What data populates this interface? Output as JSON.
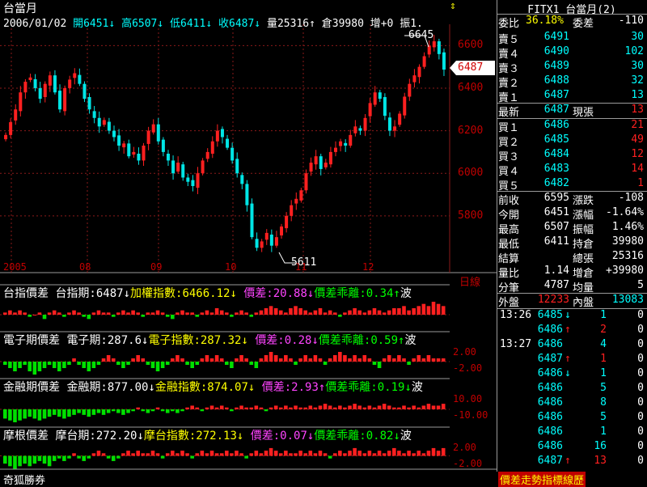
{
  "chart": {
    "symbol": "台當月",
    "info": [
      {
        "t": "2006/01/02",
        "c": "white"
      },
      {
        "t": "開6451↓",
        "c": "cyan"
      },
      {
        "t": "高6507↓",
        "c": "cyan"
      },
      {
        "t": "低6411↓",
        "c": "cyan"
      },
      {
        "t": "收6487↓",
        "c": "cyan"
      },
      {
        "t": "量25316↑",
        "c": "white"
      },
      {
        "t": "倉39980",
        "c": "white"
      },
      {
        "t": "增+0",
        "c": "white"
      },
      {
        "t": "振1.",
        "c": "white"
      }
    ],
    "y_ticks": [
      "6600",
      "6400",
      "6200",
      "6000",
      "5800"
    ],
    "x_ticks": [
      "2005",
      "08",
      "09",
      "10",
      "11",
      "12"
    ],
    "period_tag": "日線",
    "high_label": "6645",
    "low_label": "5611",
    "last_price_tag": "6487",
    "colors": {
      "up": "#ff2020",
      "down": "#00e5e5",
      "grid": "#8b1a1a"
    }
  },
  "chart_data": {
    "type": "candlestick",
    "ylim": [
      5560,
      6700
    ],
    "y_ticks": [
      6600,
      6400,
      6200,
      6000,
      5800
    ],
    "high": 6645,
    "low": 5611,
    "last": 6487,
    "closes": [
      6180,
      6240,
      6300,
      6380,
      6430,
      6450,
      6400,
      6350,
      6420,
      6460,
      6380,
      6300,
      6400,
      6440,
      6470,
      6420,
      6350,
      6300,
      6260,
      6220,
      6250,
      6200,
      6170,
      6130,
      6140,
      6080,
      6100,
      6060,
      6130,
      6200,
      6230,
      6150,
      6100,
      6060,
      6000,
      6050,
      5980,
      5960,
      5940,
      6000,
      6060,
      6100,
      6150,
      6200,
      6170,
      6120,
      6060,
      6000,
      5950,
      5850,
      5700,
      5650,
      5680,
      5720,
      5660,
      5700,
      5750,
      5800,
      5850,
      5880,
      5920,
      6000,
      6050,
      6080,
      6020,
      6050,
      6100,
      6120,
      6150,
      6130,
      6180,
      6220,
      6200,
      6260,
      6330,
      6380,
      6350,
      6270,
      6200,
      6220,
      6280,
      6360,
      6420,
      6460,
      6500,
      6550,
      6600,
      6620,
      6560,
      6487
    ]
  },
  "indicators": [
    {
      "title": "台指價差",
      "fut": "台指期:6487↓",
      "idx": "加權指數:6466.12↓",
      "diff": "價差:20.88↓",
      "dev": "價差乖離:0.34↑",
      "tail": "波",
      "scale": [],
      "values": [
        1,
        2,
        1,
        2,
        1,
        -1,
        0,
        1,
        -2,
        1,
        2,
        1,
        -1,
        1,
        2,
        1,
        -1,
        -2,
        1,
        2,
        1,
        1,
        -1,
        1,
        2,
        1,
        2,
        1,
        -1,
        1,
        1,
        2,
        1,
        -1,
        -2,
        1,
        2,
        1,
        1,
        -1,
        1,
        2,
        1,
        3,
        2,
        1,
        -1,
        1,
        2,
        1,
        -1,
        1,
        2,
        3,
        4,
        3,
        2,
        1,
        3,
        4,
        3,
        2,
        1,
        2,
        3,
        1,
        2,
        1,
        -1,
        1,
        2,
        3,
        2,
        1,
        2,
        3,
        2,
        1,
        2,
        3,
        3,
        4,
        2,
        3,
        4,
        5,
        4,
        6,
        5,
        4
      ]
    },
    {
      "title": "電子期價差",
      "fut": "電子期:287.6↓",
      "idx": "電子指數:287.32↓",
      "diff": "價差:0.28↓",
      "dev": "價差乖離:0.59↑",
      "tail": "波",
      "scale": [
        "2.00",
        "-2.00"
      ],
      "values": [
        -1,
        -2,
        -3,
        -2,
        -1,
        -3,
        -4,
        -3,
        -2,
        -1,
        -2,
        -3,
        -2,
        -1,
        1,
        -1,
        -2,
        -3,
        -2,
        -1,
        1,
        2,
        1,
        -1,
        -2,
        -1,
        1,
        2,
        1,
        -1,
        -2,
        -3,
        -2,
        -1,
        1,
        2,
        1,
        -1,
        -2,
        -1,
        1,
        2,
        1,
        2,
        1,
        -1,
        -2,
        1,
        2,
        1,
        -1,
        -2,
        1,
        2,
        3,
        2,
        1,
        2,
        1,
        -1,
        1,
        2,
        1,
        2,
        1,
        -1,
        1,
        2,
        3,
        2,
        1,
        2,
        1,
        2,
        1,
        -1,
        -2,
        1,
        2,
        1,
        2,
        1,
        -1,
        1,
        2,
        1,
        2,
        1,
        1,
        1
      ]
    },
    {
      "title": "金融期價差",
      "fut": "金融期:877.00↓",
      "idx": "金融指數:874.07↓",
      "diff": "價差:2.93↑",
      "dev": "價差乖離:0.19↓",
      "tail": "波",
      "scale": [
        "10.00",
        "-10.00"
      ],
      "values": [
        -5,
        -6,
        -7,
        -6,
        -5,
        -4,
        -5,
        -6,
        -5,
        -4,
        -3,
        -4,
        -5,
        -4,
        -3,
        -2,
        -3,
        -4,
        -3,
        -2,
        -3,
        -2,
        -1,
        -2,
        -3,
        -2,
        -1,
        1,
        -1,
        -2,
        -1,
        1,
        -1,
        -2,
        -1,
        -2,
        -1,
        1,
        2,
        1,
        -1,
        1,
        2,
        1,
        2,
        1,
        -1,
        1,
        2,
        1,
        1,
        2,
        1,
        -1,
        1,
        2,
        1,
        2,
        1,
        2,
        1,
        1,
        2,
        1,
        2,
        3,
        2,
        1,
        2,
        1,
        2,
        3,
        2,
        1,
        2,
        1,
        2,
        3,
        2,
        1,
        1,
        2,
        1,
        2,
        1,
        2,
        3,
        2,
        2,
        3
      ]
    },
    {
      "title": "摩根價差",
      "fut": "摩台期:272.20↓",
      "idx": "摩台指數:272.13↓",
      "diff": "價差:0.07↓",
      "dev": "價差乖離:0.82↓",
      "tail": "波",
      "scale": [
        "2.00",
        "-2.00"
      ],
      "values": [
        -3,
        -4,
        -5,
        -4,
        -3,
        -4,
        -3,
        -2,
        -3,
        -4,
        -2,
        -1,
        -2,
        -1,
        1,
        -1,
        -2,
        -1,
        1,
        2,
        1,
        -1,
        -2,
        -1,
        1,
        2,
        1,
        2,
        1,
        1,
        2,
        1,
        -1,
        1,
        2,
        1,
        2,
        1,
        -1,
        1,
        2,
        1,
        2,
        1,
        1,
        2,
        1,
        2,
        1,
        -1,
        1,
        2,
        1,
        2,
        3,
        2,
        1,
        2,
        1,
        1,
        2,
        1,
        2,
        1,
        2,
        1,
        -1,
        1,
        2,
        1,
        2,
        3,
        2,
        1,
        2,
        1,
        2,
        1,
        2,
        3,
        2,
        1,
        2,
        1,
        2,
        1,
        2,
        3,
        2,
        3
      ]
    }
  ],
  "status_bar": {
    "left": "奇狐勝券",
    "right": "價差走勢指標線歷"
  },
  "quote": {
    "header": "FITX1 台當月(2)",
    "ratio": {
      "label": "委比",
      "pct": "36.18%",
      "diff_label": "委差",
      "diff": "-110"
    },
    "asks": [
      {
        "label": "賣５",
        "price": "6491",
        "vol": "30"
      },
      {
        "label": "賣４",
        "price": "6490",
        "vol": "102"
      },
      {
        "label": "賣３",
        "price": "6489",
        "vol": "30"
      },
      {
        "label": "賣２",
        "price": "6488",
        "vol": "32"
      },
      {
        "label": "賣１",
        "price": "6487",
        "vol": "13"
      }
    ],
    "last": {
      "label": "最新",
      "price": "6487",
      "vol_label": "現張",
      "vol": "13"
    },
    "bids": [
      {
        "label": "買１",
        "price": "6486",
        "vol": "21"
      },
      {
        "label": "買２",
        "price": "6485",
        "vol": "49"
      },
      {
        "label": "買３",
        "price": "6484",
        "vol": "12"
      },
      {
        "label": "買４",
        "price": "6483",
        "vol": "14"
      },
      {
        "label": "買５",
        "price": "6482",
        "vol": "1"
      }
    ],
    "stats": [
      {
        "l1": "前收",
        "v1": "6595",
        "c1": "white",
        "l2": "漲跌",
        "v2": "-108",
        "c2": "white"
      },
      {
        "l1": "今開",
        "v1": "6451",
        "c1": "white",
        "l2": "漲幅",
        "v2": "-1.64%",
        "c2": "white"
      },
      {
        "l1": "最高",
        "v1": "6507",
        "c1": "white",
        "l2": "振幅",
        "v2": "1.46%",
        "c2": "white"
      },
      {
        "l1": "最低",
        "v1": "6411",
        "c1": "white",
        "l2": "持倉",
        "v2": "39980",
        "c2": "white"
      },
      {
        "l1": "結算",
        "v1": "",
        "c1": "white",
        "l2": "總張",
        "v2": "25316",
        "c2": "white"
      },
      {
        "l1": "量比",
        "v1": "1.14",
        "c1": "white",
        "l2": "增倉",
        "v2": "+39980",
        "c2": "white"
      },
      {
        "l1": "分筆",
        "v1": "4787",
        "c1": "white",
        "l2": "均量",
        "v2": "5",
        "c2": "white"
      }
    ],
    "outer": {
      "label": "外盤",
      "value": "12233"
    },
    "inner": {
      "label": "內盤",
      "value": "13083"
    },
    "ticks": [
      {
        "time": "13:26",
        "price": "6485",
        "arrow": "↓",
        "vol": "1",
        "x": "0"
      },
      {
        "time": "",
        "price": "6486",
        "arrow": "↑",
        "vol": "2",
        "x": "0"
      },
      {
        "time": "13:27",
        "price": "6486",
        "arrow": "",
        "vol": "4",
        "x": "0"
      },
      {
        "time": "",
        "price": "6487",
        "arrow": "↑",
        "vol": "1",
        "x": "0"
      },
      {
        "time": "",
        "price": "6486",
        "arrow": "↓",
        "vol": "1",
        "x": "0"
      },
      {
        "time": "",
        "price": "6486",
        "arrow": "",
        "vol": "5",
        "x": "0"
      },
      {
        "time": "",
        "price": "6486",
        "arrow": "",
        "vol": "8",
        "x": "0"
      },
      {
        "time": "",
        "price": "6486",
        "arrow": "",
        "vol": "5",
        "x": "0"
      },
      {
        "time": "",
        "price": "6486",
        "arrow": "",
        "vol": "1",
        "x": "0"
      },
      {
        "time": "",
        "price": "6486",
        "arrow": "",
        "vol": "16",
        "x": "0"
      },
      {
        "time": "",
        "price": "6487",
        "arrow": "↑",
        "vol": "13",
        "x": "0"
      }
    ]
  }
}
